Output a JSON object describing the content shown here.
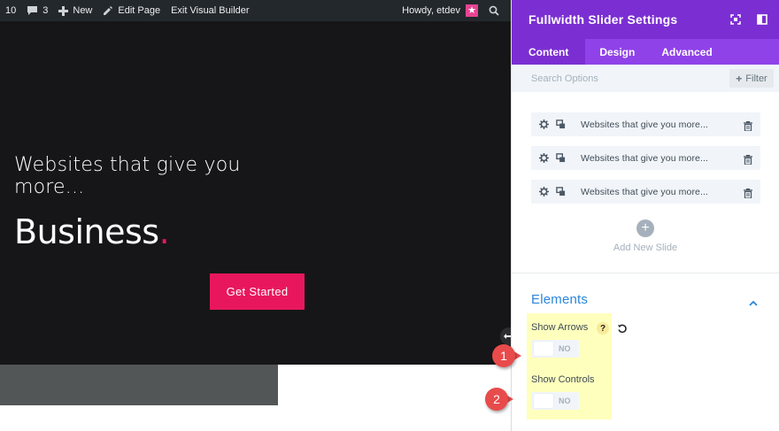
{
  "adminbar": {
    "count_label": "10",
    "comments_count": "3",
    "new_label": "New",
    "edit_page_label": "Edit Page",
    "exit_builder_label": "Exit Visual Builder",
    "howdy_label": "Howdy, etdev"
  },
  "hero": {
    "subtitle": "Websites that give you more...",
    "title": "Business",
    "title_dot": ".",
    "cta_label": "Get Started",
    "accent_color": "#e8175d"
  },
  "panel": {
    "title": "Fullwidth Slider Settings",
    "tabs": [
      {
        "label": "Content",
        "active": true
      },
      {
        "label": "Design",
        "active": false
      },
      {
        "label": "Advanced",
        "active": false
      }
    ],
    "search": {
      "placeholder": "Search Options"
    },
    "filter_label": "Filter",
    "slides": [
      {
        "label": "Websites that give you more..."
      },
      {
        "label": "Websites that give you more..."
      },
      {
        "label": "Websites that give you more..."
      }
    ],
    "add_slide_label": "Add New Slide",
    "elements": {
      "title": "Elements",
      "options": [
        {
          "label": "Show Arrows",
          "value": "NO"
        },
        {
          "label": "Show Controls",
          "value": "NO"
        }
      ]
    },
    "header_color": "#7b2fd3"
  },
  "callouts": [
    "1",
    "2"
  ]
}
